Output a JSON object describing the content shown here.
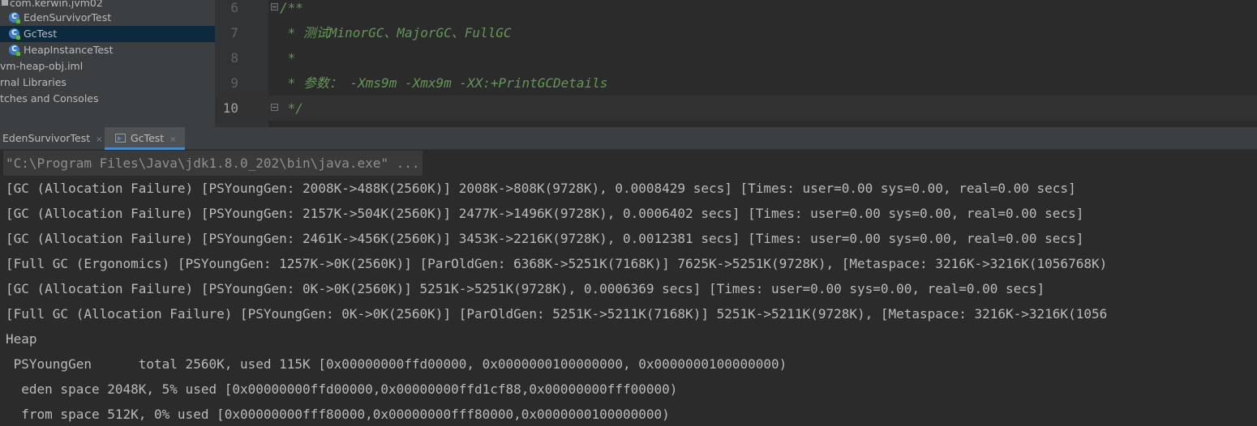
{
  "project_tree": {
    "items": [
      {
        "label": "com.kerwin.jvm02",
        "icon": "package-icon"
      },
      {
        "label": "EdenSurvivorTest",
        "icon": "java-class-icon"
      },
      {
        "label": "GcTest",
        "icon": "java-class-icon",
        "selected": true
      },
      {
        "label": "HeapInstanceTest",
        "icon": "java-class-icon"
      },
      {
        "label": "vm-heap-obj.iml",
        "icon": "none"
      },
      {
        "label": "rnal Libraries",
        "icon": "none"
      },
      {
        "label": "tches and Consoles",
        "icon": "none"
      }
    ]
  },
  "editor": {
    "lines": [
      {
        "number": "6",
        "text": "/**"
      },
      {
        "number": "7",
        "text": " * 测试MinorGC、MajorGC、FullGC"
      },
      {
        "number": "8",
        "text": " *"
      },
      {
        "number": "9",
        "text": " * 参数： -Xms9m -Xmx9m -XX:+PrintGCDetails"
      },
      {
        "number": "10",
        "text": " */"
      }
    ],
    "comment_color": "#629755"
  },
  "run_tabs": [
    {
      "label": "EdenSurvivorTest",
      "close": "×"
    },
    {
      "label": "GcTest",
      "close": "×",
      "active": true
    }
  ],
  "console": {
    "command": "\"C:\\Program Files\\Java\\jdk1.8.0_202\\bin\\java.exe\" ...",
    "lines": [
      "[GC (Allocation Failure) [PSYoungGen: 2008K->488K(2560K)] 2008K->808K(9728K), 0.0008429 secs] [Times: user=0.00 sys=0.00, real=0.00 secs]",
      "[GC (Allocation Failure) [PSYoungGen: 2157K->504K(2560K)] 2477K->1496K(9728K), 0.0006402 secs] [Times: user=0.00 sys=0.00, real=0.00 secs]",
      "[GC (Allocation Failure) [PSYoungGen: 2461K->456K(2560K)] 3453K->2216K(9728K), 0.0012381 secs] [Times: user=0.00 sys=0.00, real=0.00 secs]",
      "[Full GC (Ergonomics) [PSYoungGen: 1257K->0K(2560K)] [ParOldGen: 6368K->5251K(7168K)] 7625K->5251K(9728K), [Metaspace: 3216K->3216K(1056768K)",
      "[GC (Allocation Failure) [PSYoungGen: 0K->0K(2560K)] 5251K->5251K(9728K), 0.0006369 secs] [Times: user=0.00 sys=0.00, real=0.00 secs]",
      "[Full GC (Allocation Failure) [PSYoungGen: 0K->0K(2560K)] [ParOldGen: 5251K->5211K(7168K)] 5251K->5211K(9728K), [Metaspace: 3216K->3216K(1056",
      "Heap",
      " PSYoungGen      total 2560K, used 115K [0x00000000ffd00000, 0x0000000100000000, 0x0000000100000000)",
      "  eden space 2048K, 5% used [0x00000000ffd00000,0x00000000ffd1cf88,0x00000000fff00000)",
      "  from space 512K, 0% used [0x00000000fff80000,0x00000000fff80000,0x0000000100000000)"
    ]
  }
}
